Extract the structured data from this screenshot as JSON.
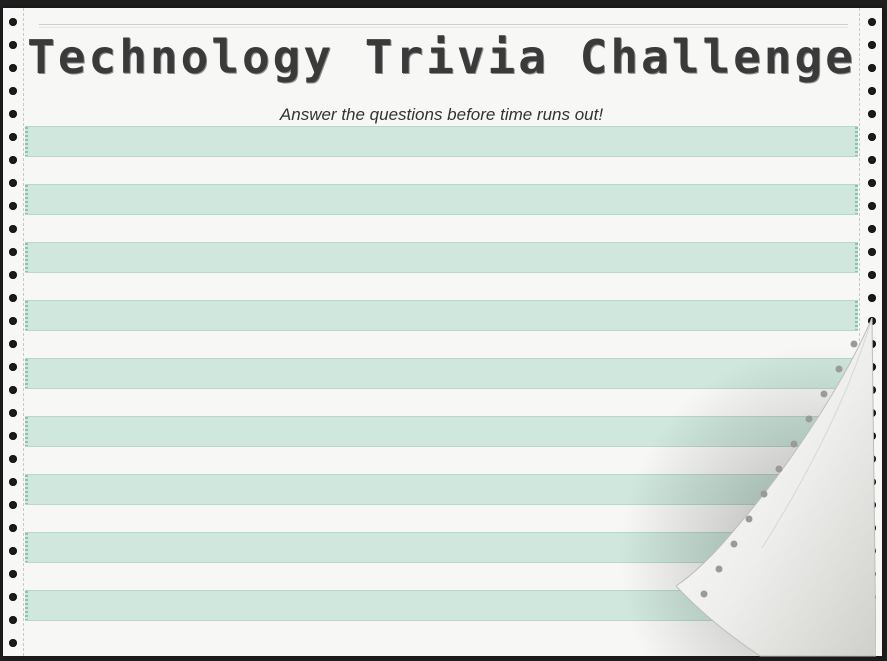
{
  "page": {
    "title": "Technology Trivia Challenge",
    "subtitle": "Answer the questions before time runs out!"
  },
  "colors": {
    "stripe": "#cfe7dd",
    "paper": "#f7f7f5",
    "title_text": "#3a3a3a"
  },
  "icons": {
    "left_holes": "tractor-feed-hole-icon",
    "right_holes": "tractor-feed-hole-icon",
    "page_curl": "page-curl-icon"
  },
  "stripes": {
    "count": 9
  }
}
